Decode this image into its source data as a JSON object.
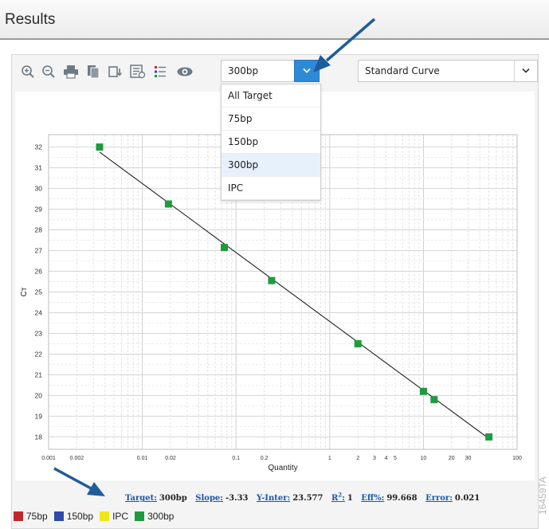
{
  "window": {
    "title": "Results"
  },
  "toolbar": {
    "icons": [
      "zoom-in-icon",
      "zoom-out-icon",
      "print-icon",
      "copy-icon",
      "export-icon",
      "settings-icon",
      "legend-icon",
      "show-icon"
    ],
    "target_select": {
      "value": "300bp"
    },
    "plot_select": {
      "value": "Standard Curve"
    }
  },
  "dropdown": {
    "options": [
      "All Target",
      "75bp",
      "150bp",
      "300bp",
      "IPC"
    ],
    "selected": "300bp"
  },
  "chart_title_fragment": "ve",
  "chart_data": {
    "type": "scatter",
    "xlabel": "Quantity",
    "ylabel": "Cт",
    "xscale": "log",
    "xlim": [
      0.001,
      100
    ],
    "ylim": [
      17.4,
      32.6
    ],
    "grid": true,
    "x_ticks": [
      "0.001",
      "0.002",
      "0.01",
      "0.02",
      "0.1",
      "0.2",
      "1",
      "2",
      "3",
      "4",
      "5",
      "10",
      "20",
      "30",
      "100"
    ],
    "x_tick_values": [
      0.001,
      0.002,
      0.01,
      0.02,
      0.1,
      0.2,
      1,
      2,
      3,
      4,
      5,
      10,
      20,
      30,
      100
    ],
    "y_ticks": [
      "18",
      "19",
      "20",
      "21",
      "22",
      "23",
      "24",
      "25",
      "26",
      "27",
      "28",
      "29",
      "30",
      "31",
      "32"
    ],
    "series": [
      {
        "name": "300bp",
        "color": "#1f9a3e",
        "points": [
          [
            0.0035,
            32.0
          ],
          [
            0.019,
            29.25
          ],
          [
            0.075,
            27.15
          ],
          [
            0.24,
            25.55
          ],
          [
            2.0,
            22.5
          ],
          [
            10.0,
            20.2
          ],
          [
            13.0,
            19.8
          ],
          [
            50.0,
            18.0
          ]
        ]
      }
    ],
    "fit_line": {
      "slope": -3.33,
      "intercept": 23.577
    }
  },
  "stats": {
    "target_label": "Target:",
    "target_value": "300bp",
    "slope_label": "Slope:",
    "slope_value": "-3.33",
    "yinter_label": "Y-Inter:",
    "yinter_value": "23.577",
    "r2_label": "R2:",
    "r2_value": "1",
    "eff_label": "Eff%:",
    "eff_value": "99.668",
    "error_label": "Error:",
    "error_value": "0.021"
  },
  "legend": [
    {
      "label": "75bp",
      "color": "#c0282d"
    },
    {
      "label": "150bp",
      "color": "#2f4aa8"
    },
    {
      "label": "IPC",
      "color": "#ece61a"
    },
    {
      "label": "300bp",
      "color": "#1f9a3e"
    }
  ],
  "figure_code": "16459TA",
  "accent": "#2f8ad6",
  "annotation_color": "#1f5c99"
}
